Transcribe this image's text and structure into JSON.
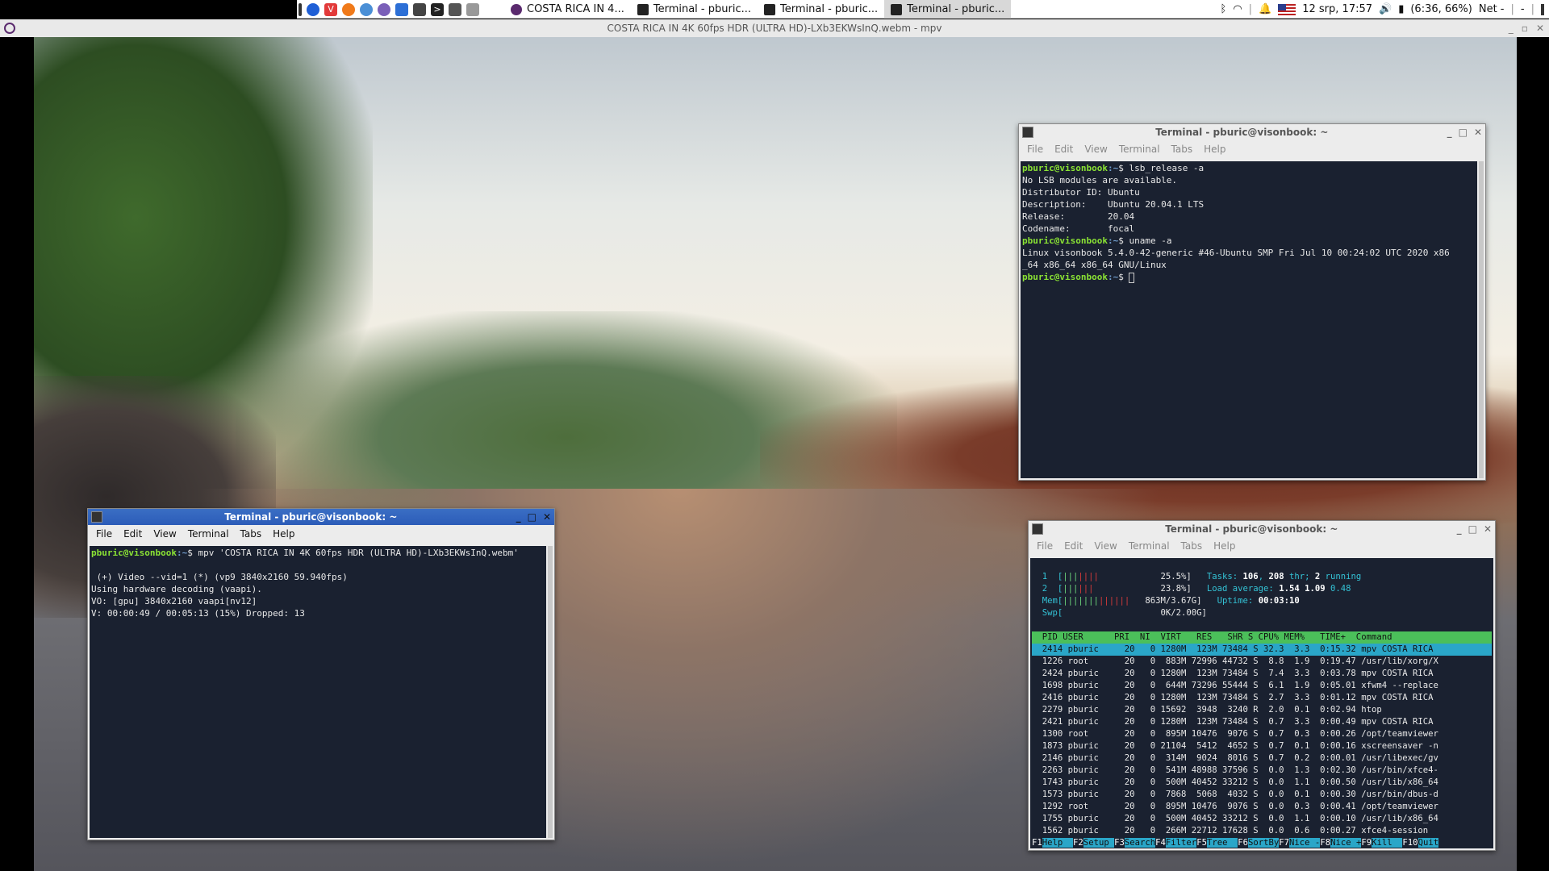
{
  "panel": {
    "launchers": [
      "blue-circle-app",
      "vivaldi",
      "firefox",
      "chromium",
      "tor",
      "notes",
      "calculator",
      "terminal",
      "display",
      "files"
    ],
    "tasks": [
      {
        "label": "COSTA RICA IN 4...",
        "icon": "mpv-icon",
        "active": false
      },
      {
        "label": "Terminal - pburic...",
        "icon": "terminal-icon",
        "active": false
      },
      {
        "label": "Terminal - pburic...",
        "icon": "terminal-icon",
        "active": false
      },
      {
        "label": "Terminal - pburic...",
        "icon": "terminal-icon",
        "active": true
      }
    ],
    "clock": "12 srp, 17:57",
    "battery": "(6:36, 66%)",
    "net": "Net -",
    "dash": "-"
  },
  "mpv": {
    "title": "COSTA RICA IN 4K 60fps HDR (ULTRA HD)-LXb3EKWsInQ.webm - mpv"
  },
  "menu": {
    "file": "File",
    "edit": "Edit",
    "view": "View",
    "terminal": "Terminal",
    "tabs": "Tabs",
    "help": "Help"
  },
  "term1": {
    "title": "Terminal - pburic@visonbook: ~",
    "lines": [
      {
        "prompt": "pburic@visonbook",
        "path": ":~",
        "cmd": "$ lsb_release -a"
      },
      {
        "text": "No LSB modules are available."
      },
      {
        "text": "Distributor ID: Ubuntu"
      },
      {
        "text": "Description:    Ubuntu 20.04.1 LTS"
      },
      {
        "text": "Release:        20.04"
      },
      {
        "text": "Codename:       focal"
      },
      {
        "prompt": "pburic@visonbook",
        "path": ":~",
        "cmd": "$ uname -a"
      },
      {
        "text": "Linux visonbook 5.4.0-42-generic #46-Ubuntu SMP Fri Jul 10 00:24:02 UTC 2020 x86"
      },
      {
        "text": "_64 x86_64 x86_64 GNU/Linux"
      },
      {
        "prompt": "pburic@visonbook",
        "path": ":~",
        "cmd": "$ ",
        "cursor": true
      }
    ]
  },
  "term2": {
    "title": "Terminal - pburic@visonbook: ~",
    "lines": [
      {
        "prompt": "pburic@visonbook",
        "path": ":~",
        "cmd": "$ mpv 'COSTA RICA IN 4K 60fps HDR (ULTRA HD)-LXb3EKWsInQ.webm'"
      },
      {
        "text": ""
      },
      {
        "text": " (+) Video --vid=1 (*) (vp9 3840x2160 59.940fps)"
      },
      {
        "text": "Using hardware decoding (vaapi)."
      },
      {
        "text": "VO: [gpu] 3840x2160 vaapi[nv12]"
      },
      {
        "text": "V: 00:00:49 / 00:05:13 (15%) Dropped: 13"
      }
    ]
  },
  "htop": {
    "title": "Terminal - pburic@visonbook: ~",
    "cpu1": {
      "label": "1",
      "pct": "25.5%"
    },
    "cpu2": {
      "label": "2",
      "pct": "23.8%"
    },
    "mem": {
      "label": "Mem",
      "val": "863M/3.67G"
    },
    "swp": {
      "label": "Swp",
      "val": "0K/2.00G"
    },
    "tasks": "106",
    "thr": "208",
    "running": "2",
    "load1": "1.54",
    "load5": "1.09",
    "load15": "0.48",
    "uptime": "00:03:10",
    "header": "  PID USER      PRI  NI  VIRT   RES   SHR S CPU% MEM%   TIME+  Command",
    "rows": [
      "2414 pburic     20   0 1280M  123M 73484 S 32.3  3.3  0:15.32 mpv COSTA RICA",
      "1226 root       20   0  883M 72996 44732 S  8.8  1.9  0:19.47 /usr/lib/xorg/X",
      "2424 pburic     20   0 1280M  123M 73484 S  7.4  3.3  0:03.78 mpv COSTA RICA",
      "1698 pburic     20   0  644M 73296 55444 S  6.1  1.9  0:05.01 xfwm4 --replace",
      "2416 pburic     20   0 1280M  123M 73484 S  2.7  3.3  0:01.12 mpv COSTA RICA",
      "2279 pburic     20   0 15692  3948  3240 R  2.0  0.1  0:02.94 htop",
      "2421 pburic     20   0 1280M  123M 73484 S  0.7  3.3  0:00.49 mpv COSTA RICA",
      "1300 root       20   0  895M 10476  9076 S  0.7  0.3  0:00.26 /opt/teamviewer",
      "1873 pburic     20   0 21104  5412  4652 S  0.7  0.1  0:00.16 xscreensaver -n",
      "2146 pburic     20   0  314M  9024  8016 S  0.7  0.2  0:00.01 /usr/libexec/gv",
      "2263 pburic     20   0  541M 48988 37596 S  0.0  1.3  0:02.30 /usr/bin/xfce4-",
      "1743 pburic     20   0  500M 40452 33212 S  0.0  1.1  0:00.50 /usr/lib/x86_64",
      "1573 pburic     20   0  7868  5068  4032 S  0.0  0.1  0:00.30 /usr/bin/dbus-d",
      "1292 root       20   0  895M 10476  9076 S  0.0  0.3  0:00.41 /opt/teamviewer",
      "1755 pburic     20   0  500M 40452 33212 S  0.0  1.1  0:00.10 /usr/lib/x86_64",
      "1562 pburic     20   0  266M 22712 17628 S  0.0  0.6  0:00.27 xfce4-session"
    ],
    "fkeys": [
      {
        "k": "F1",
        "l": "Help  "
      },
      {
        "k": "F2",
        "l": "Setup "
      },
      {
        "k": "F3",
        "l": "Search"
      },
      {
        "k": "F4",
        "l": "Filter"
      },
      {
        "k": "F5",
        "l": "Tree  "
      },
      {
        "k": "F6",
        "l": "SortBy"
      },
      {
        "k": "F7",
        "l": "Nice -"
      },
      {
        "k": "F8",
        "l": "Nice +"
      },
      {
        "k": "F9",
        "l": "Kill  "
      },
      {
        "k": "F10",
        "l": "Quit"
      }
    ]
  }
}
